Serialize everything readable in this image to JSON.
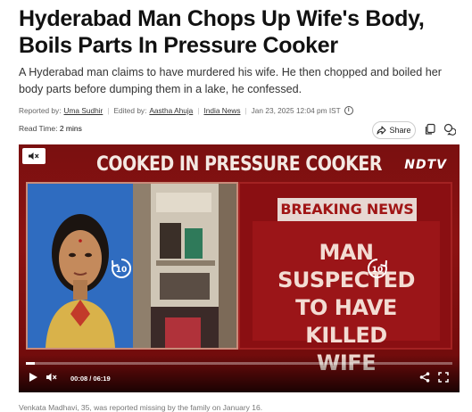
{
  "article": {
    "headline": "Hyderabad Man Chops Up Wife's Body, Boils Parts In Pressure Cooker",
    "summary": "A Hyderabad man claims to have murdered his wife. He then chopped and boiled her body parts before dumping them in a lake, he confessed.",
    "meta": {
      "reported_by_label": "Reported by:",
      "reporter": "Uma Sudhir",
      "edited_by_label": "Edited by:",
      "editor": "Aastha Ahuja",
      "section": "India News",
      "date": "Jan 23, 2025 12:04 pm IST",
      "info_icon": "info-icon"
    },
    "read_time_label": "Read Time:",
    "read_time": "2 mins",
    "caption": "Venkata Madhavi, 35, was reported missing by the family on January 16."
  },
  "toolbar": {
    "share_label": "Share",
    "share_icon": "share-arrow-icon",
    "copy_icon": "copy-icon",
    "comment_icon": "comment-icon"
  },
  "video": {
    "banner_title": "COOKED IN PRESSURE COOKER",
    "logo": "NDTV",
    "breaking_label": "BREAKING NEWS",
    "headline_lines": [
      "MAN SUSPECTED",
      "TO HAVE KILLED",
      "WIFE"
    ],
    "seek_back_label": "10",
    "seek_forward_label": "10",
    "current_time": "00:08",
    "duration": "06:19",
    "time_display": "00:08 / 06:19",
    "progress_fraction": 0.02,
    "colors": {
      "background": "#8c1212",
      "breaking_text": "#a01515"
    }
  }
}
